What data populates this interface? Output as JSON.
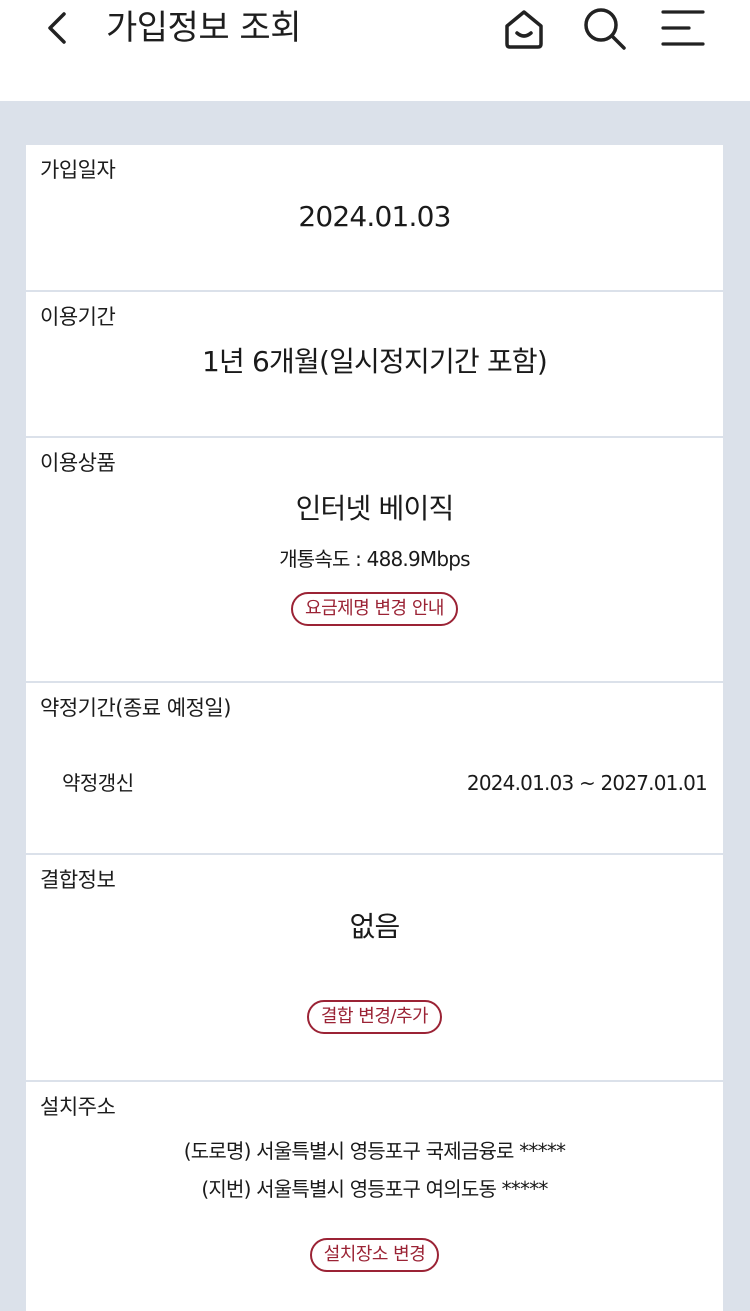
{
  "header": {
    "title": "가입정보 조회",
    "icons": [
      "chevron-left-icon",
      "home-icon",
      "search-icon",
      "menu-icon"
    ]
  },
  "join_date": {
    "label": "가입일자",
    "value": "2024.01.03"
  },
  "usage_period": {
    "label": "이용기간",
    "value": "1년 6개월(일시정지기간 포함)"
  },
  "product": {
    "label": "이용상품",
    "value": "인터넷 베이직",
    "speed": "개통속도 : 488.9Mbps",
    "button": "요금제명 변경 안내"
  },
  "contract": {
    "label": "약정기간(종료 예정일)",
    "row_label": "약정갱신",
    "row_value": "2024.01.03 ~ 2027.01.01"
  },
  "bundle": {
    "label": "결합정보",
    "value": "없음",
    "button": "결합 변경/추가"
  },
  "address": {
    "label": "설치주소",
    "road": "(도로명) 서울특별시 영등포구 국제금융로 *****",
    "lot": "(지번) 서울특별시 영등포구 여의도동 *****",
    "button": "설치장소 변경"
  },
  "colors": {
    "accent": "#9b2335",
    "background": "#dbe1ea"
  }
}
